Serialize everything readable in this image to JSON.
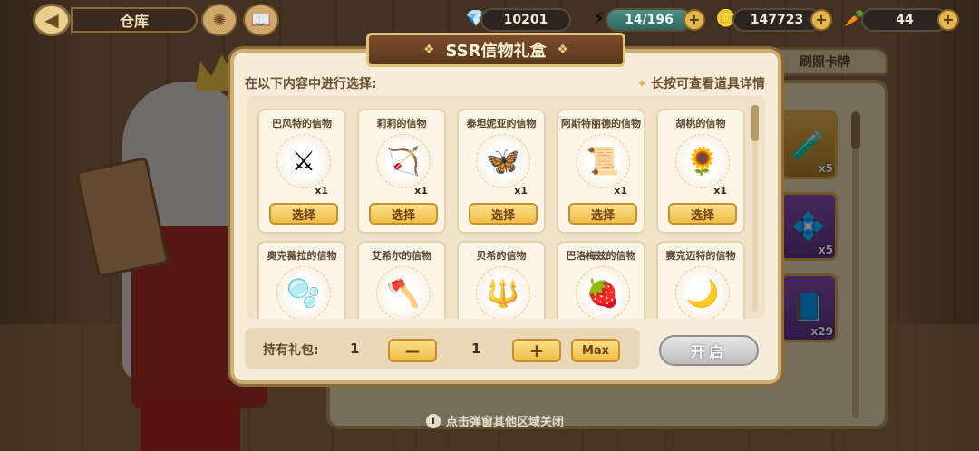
{
  "topbar": {
    "title": "仓库",
    "back_icon": "back-arrow-icon",
    "resources": [
      {
        "name": "crystal",
        "icon": "💎",
        "value": "10201"
      },
      {
        "name": "stamina",
        "icon": "⚡",
        "value": "14/196"
      },
      {
        "name": "coin",
        "icon": "🪙",
        "value": "147723"
      },
      {
        "name": "carrot",
        "icon": "🥕",
        "value": "44"
      }
    ]
  },
  "background_tab": {
    "label": "刷照卡牌"
  },
  "background_slots": [
    {
      "icon": "🧪",
      "count": "x5"
    },
    {
      "icon": "💠",
      "count": "x5"
    },
    {
      "icon": "📘",
      "count": "x29"
    }
  ],
  "modal": {
    "title": "SSR信物礼盒",
    "prompt": "在以下内容中进行选择:",
    "hint": "长按可查看道具详情",
    "select_label": "选择",
    "items": [
      {
        "name": "巴风特的信物",
        "icon": "⚔",
        "qty": "x1"
      },
      {
        "name": "莉莉的信物",
        "icon": "🏹",
        "qty": "x1"
      },
      {
        "name": "泰坦妮亚的信物",
        "icon": "🦋",
        "qty": "x1"
      },
      {
        "name": "阿斯特丽德的信物",
        "icon": "📜",
        "qty": "x1"
      },
      {
        "name": "胡桃的信物",
        "icon": "🌻",
        "qty": "x1"
      },
      {
        "name": "奥克薇拉的信物",
        "icon": "🫧",
        "qty": ""
      },
      {
        "name": "艾希尔的信物",
        "icon": "🪓",
        "qty": ""
      },
      {
        "name": "贝希的信物",
        "icon": "🔱",
        "qty": ""
      },
      {
        "name": "巴洛梅兹的信物",
        "icon": "🍓",
        "qty": ""
      },
      {
        "name": "赛克迈特的信物",
        "icon": "🌙",
        "qty": ""
      }
    ],
    "hold_label": "持有礼包:",
    "hold_value": "1",
    "minus_label": "—",
    "qty_value": "1",
    "plus_label": "+",
    "max_label": "Max",
    "open_label": "开启"
  },
  "close_tip": "点击弹窗其他区域关闭"
}
